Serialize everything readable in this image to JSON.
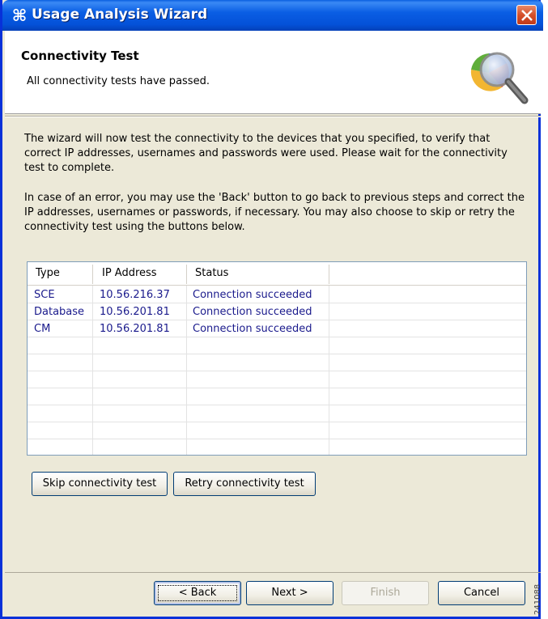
{
  "window": {
    "title": "Usage Analysis Wizard",
    "title_icon": "⌘"
  },
  "header": {
    "title": "Connectivity Test",
    "subtitle": "All connectivity tests have passed."
  },
  "body": {
    "para1": "The wizard will now test the connectivity to the devices that you specified, to verify that correct IP addresses, usernames and passwords were used. Please wait for the connectivity test to complete.",
    "para2": "In case of an error, you may use the 'Back' button to go back to previous steps and correct the IP addresses, usernames or passwords, if necessary. You may also choose to skip or retry the connectivity test using the buttons below."
  },
  "table": {
    "columns": [
      "Type",
      "IP Address",
      "Status"
    ],
    "rows": [
      [
        "SCE",
        "10.56.216.37",
        "Connection succeeded"
      ],
      [
        "Database",
        "10.56.201.81",
        "Connection succeeded"
      ],
      [
        "CM",
        "10.56.201.81",
        "Connection succeeded"
      ]
    ]
  },
  "actions": {
    "skip_label": "Skip connectivity test",
    "retry_label": "Retry connectivity test"
  },
  "footer": {
    "back_label": "< Back",
    "next_label": "Next >",
    "finish_label": "Finish",
    "cancel_label": "Cancel"
  },
  "side_mark": "241088",
  "colors": {
    "titlebar": "#0451d8",
    "cell_text": "#1a1a8c",
    "close_red": "#d5502b"
  }
}
